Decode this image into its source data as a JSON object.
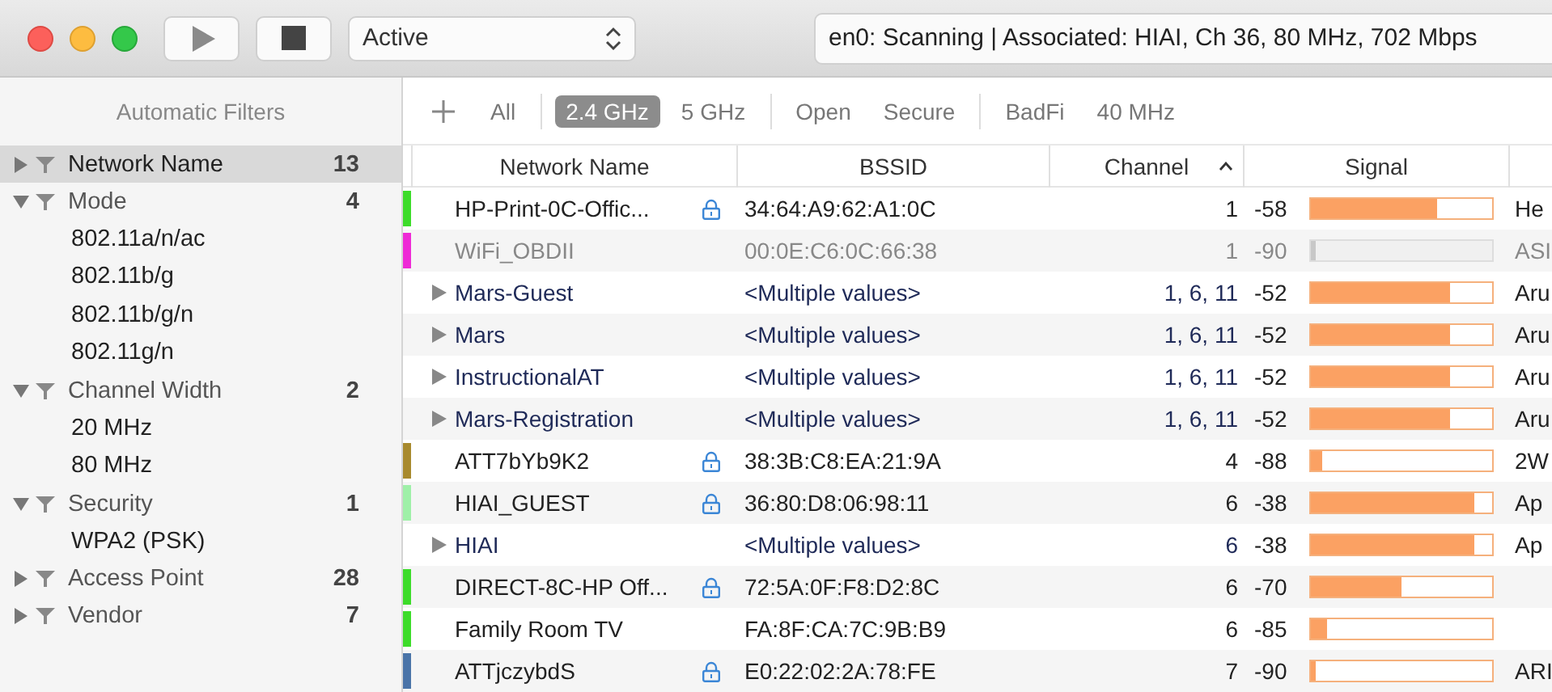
{
  "toolbar": {
    "scope": "Active",
    "status": "en0: Scanning  |  Associated: HIAI, Ch 36, 80 MHz, 702 Mbps"
  },
  "sidebar": {
    "title": "Automatic Filters",
    "filters": [
      {
        "label": "Network Name",
        "count": "13",
        "expanded": false,
        "selected": true
      },
      {
        "label": "Mode",
        "count": "4",
        "expanded": true,
        "selected": false,
        "children": [
          {
            "label": "802.11a/n/ac"
          },
          {
            "label": "802.11b/g"
          },
          {
            "label": "802.11b/g/n"
          },
          {
            "label": "802.11g/n"
          }
        ]
      },
      {
        "label": "Channel Width",
        "count": "2",
        "expanded": true,
        "selected": false,
        "children": [
          {
            "label": "20 MHz"
          },
          {
            "label": "80 MHz"
          }
        ]
      },
      {
        "label": "Security",
        "count": "1",
        "expanded": true,
        "selected": false,
        "children": [
          {
            "label": "WPA2 (PSK)"
          }
        ]
      },
      {
        "label": "Access Point",
        "count": "28",
        "expanded": false,
        "selected": false
      },
      {
        "label": "Vendor",
        "count": "7",
        "expanded": false,
        "selected": false
      }
    ]
  },
  "filter_bar": {
    "groups": [
      [
        {
          "label": "All",
          "selected": false
        }
      ],
      [
        {
          "label": "2.4 GHz",
          "selected": true
        },
        {
          "label": "5 GHz",
          "selected": false
        }
      ],
      [
        {
          "label": "Open",
          "selected": false
        },
        {
          "label": "Secure",
          "selected": false
        }
      ],
      [
        {
          "label": "BadFi",
          "selected": false
        },
        {
          "label": "40 MHz",
          "selected": false
        }
      ]
    ]
  },
  "table": {
    "columns": [
      {
        "label": "Network Name",
        "sorted": false
      },
      {
        "label": "BSSID",
        "sorted": false
      },
      {
        "label": "Channel",
        "sorted": true
      },
      {
        "label": "Signal",
        "sorted": false
      }
    ],
    "rows": [
      {
        "name": "HP-Print-0C-Offic...",
        "color": "#3ddc2a",
        "locked": true,
        "expandable": false,
        "disabled": false,
        "bssid": "34:64:A9:62:A1:0C",
        "channel": "1",
        "rssi": "-58",
        "level": 0.7,
        "vendor": "He"
      },
      {
        "name": "WiFi_OBDII",
        "color": "#ee2ad6",
        "locked": false,
        "expandable": false,
        "disabled": true,
        "bssid": "00:0E:C6:0C:66:38",
        "channel": "1",
        "rssi": "-90",
        "level": 0.03,
        "vendor": "ASI"
      },
      {
        "name": "Mars-Guest",
        "locked": false,
        "expandable": true,
        "disabled": false,
        "bssid": "<Multiple values>",
        "channel": "1, 6, 11",
        "rssi": "-52",
        "level": 0.77,
        "vendor": "Aru"
      },
      {
        "name": "Mars",
        "locked": false,
        "expandable": true,
        "disabled": false,
        "bssid": "<Multiple values>",
        "channel": "1, 6, 11",
        "rssi": "-52",
        "level": 0.77,
        "vendor": "Aru"
      },
      {
        "name": "InstructionalAT",
        "locked": false,
        "expandable": true,
        "disabled": false,
        "bssid": "<Multiple values>",
        "channel": "1, 6, 11",
        "rssi": "-52",
        "level": 0.77,
        "vendor": "Aru"
      },
      {
        "name": "Mars-Registration",
        "locked": false,
        "expandable": true,
        "disabled": false,
        "bssid": "<Multiple values>",
        "channel": "1, 6, 11",
        "rssi": "-52",
        "level": 0.77,
        "vendor": "Aru"
      },
      {
        "name": "ATT7bYb9K2",
        "color": "#a88a2e",
        "locked": true,
        "expandable": false,
        "disabled": false,
        "bssid": "38:3B:C8:EA:21:9A",
        "channel": "4",
        "rssi": "-88",
        "level": 0.06,
        "vendor": "2W"
      },
      {
        "name": "HIAI_GUEST",
        "color": "#9ff0a8",
        "locked": true,
        "expandable": false,
        "disabled": false,
        "bssid": "36:80:D8:06:98:11",
        "channel": "6",
        "rssi": "-38",
        "level": 0.9,
        "vendor": "Ap"
      },
      {
        "name": "HIAI",
        "locked": false,
        "expandable": true,
        "disabled": false,
        "bssid": "<Multiple values>",
        "channel": "6",
        "rssi": "-38",
        "level": 0.9,
        "vendor": "Ap"
      },
      {
        "name": "DIRECT-8C-HP Off...",
        "color": "#3ddc2a",
        "locked": true,
        "expandable": false,
        "disabled": false,
        "bssid": "72:5A:0F:F8:D2:8C",
        "channel": "6",
        "rssi": "-70",
        "level": 0.5
      },
      {
        "name": "Family Room TV",
        "color": "#3ddc2a",
        "locked": false,
        "expandable": false,
        "disabled": false,
        "bssid": "FA:8F:CA:7C:9B:B9",
        "channel": "6",
        "rssi": "-85",
        "level": 0.09
      },
      {
        "name": "ATTjczybdS",
        "color": "#4a74a8",
        "locked": true,
        "expandable": false,
        "disabled": false,
        "bssid": "E0:22:02:2A:78:FE",
        "channel": "7",
        "rssi": "-90",
        "level": 0.03,
        "vendor": "ARI"
      }
    ]
  }
}
